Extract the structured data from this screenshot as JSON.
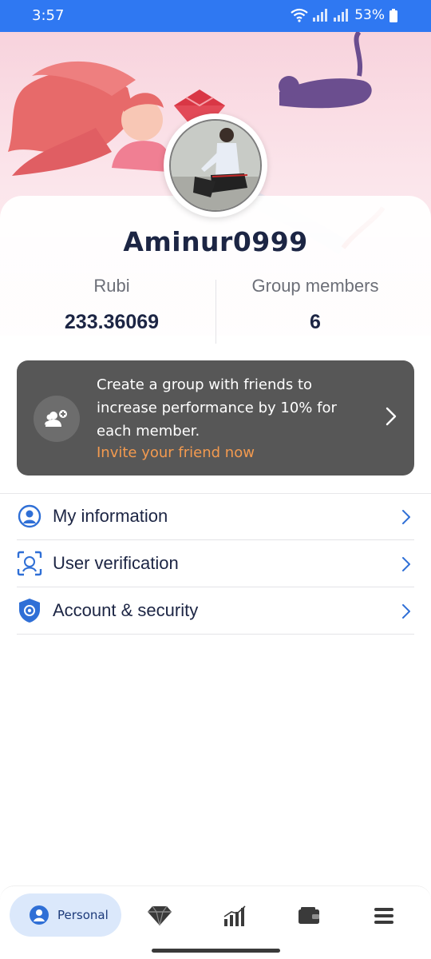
{
  "status_bar": {
    "time": "3:57",
    "battery": "53%"
  },
  "profile": {
    "username": "Aminur0999"
  },
  "stats": {
    "left": {
      "label": "Rubi",
      "value": "233.36069"
    },
    "right": {
      "label": "Group members",
      "value": "6"
    }
  },
  "promo": {
    "text": "Create a group with friends to increase performance by 10% for each member.",
    "link": "Invite your friend now"
  },
  "menu": {
    "items": [
      {
        "label": "My information",
        "icon": "user-circle-icon"
      },
      {
        "label": "User verification",
        "icon": "face-scan-icon"
      },
      {
        "label": "Account & security",
        "icon": "shield-gear-icon"
      }
    ]
  },
  "bottom_nav": {
    "active_label": "Personal",
    "items": [
      "personal-icon",
      "diamond-icon",
      "chart-bars-icon",
      "wallet-icon",
      "menu-icon"
    ]
  },
  "colors": {
    "status_bar": "#2f78f2",
    "accent_blue": "#2f6fd6",
    "promo_bg": "#575757",
    "promo_link": "#f39a4f",
    "text_dark": "#1c2544"
  }
}
